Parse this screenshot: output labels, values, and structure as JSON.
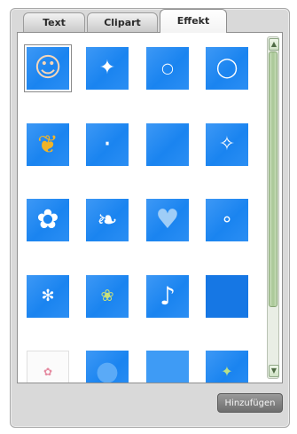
{
  "tabs": [
    {
      "label": "Text",
      "active": false
    },
    {
      "label": "Clipart",
      "active": false
    },
    {
      "label": "Effekt",
      "active": true
    }
  ],
  "add_button": {
    "label": "Hinzufügen"
  },
  "grid": {
    "items": [
      {
        "name": "effect-face",
        "icon": "face-icon",
        "glyph": "☺"
      },
      {
        "name": "effect-sparkle-stars",
        "icon": "sparkle-icon",
        "glyph": "✦"
      },
      {
        "name": "effect-small-bubbles",
        "icon": "bubbles-icon",
        "glyph": "○"
      },
      {
        "name": "effect-large-bubbles",
        "icon": "bubbles-icon",
        "glyph": "◯"
      },
      {
        "name": "effect-butterfly",
        "icon": "butterfly-icon",
        "glyph": "❦"
      },
      {
        "name": "effect-sparkle-dots",
        "icon": "sparkle-icon",
        "glyph": "·"
      },
      {
        "name": "effect-plain-blue",
        "icon": "blank-icon",
        "glyph": ""
      },
      {
        "name": "effect-falling-sparks",
        "icon": "sparkle-icon",
        "glyph": "✧"
      },
      {
        "name": "effect-flower",
        "icon": "flower-icon",
        "glyph": "✿"
      },
      {
        "name": "effect-bird",
        "icon": "bird-icon",
        "glyph": "❧"
      },
      {
        "name": "effect-heart",
        "icon": "heart-icon",
        "glyph": "♥"
      },
      {
        "name": "effect-snow-dots",
        "icon": "snow-icon",
        "glyph": "∘"
      },
      {
        "name": "effect-dandelion",
        "icon": "dandelion-icon",
        "glyph": "✻"
      },
      {
        "name": "effect-leaf",
        "icon": "leaf-icon",
        "glyph": "❀"
      },
      {
        "name": "effect-music-note",
        "icon": "music-note-icon",
        "glyph": "♪"
      },
      {
        "name": "effect-dark-blue",
        "icon": "blank-icon",
        "glyph": ""
      },
      {
        "name": "effect-white-flower",
        "icon": "flower-icon",
        "glyph": "✿"
      },
      {
        "name": "effect-blue-circle",
        "icon": "circle-icon",
        "glyph": "●"
      },
      {
        "name": "effect-light-blue",
        "icon": "blank-icon",
        "glyph": ""
      },
      {
        "name": "effect-green-sparkles",
        "icon": "sparkle-icon",
        "glyph": "✦"
      }
    ]
  },
  "colors": {
    "thumb_blue": "#1a84f0",
    "panel_bg": "#d9d9d9",
    "scrollbar_green": "#a8c795",
    "button_gray": "#7a7a7a"
  }
}
